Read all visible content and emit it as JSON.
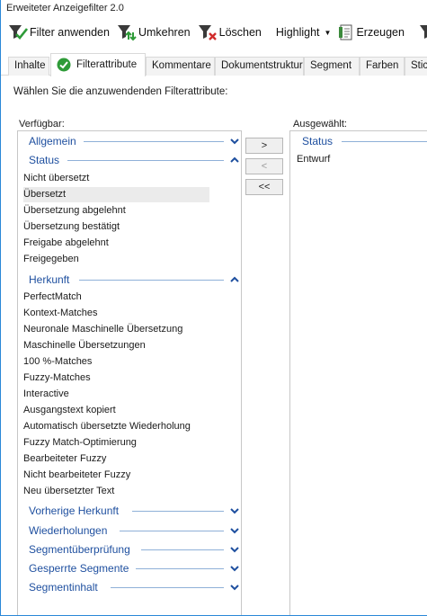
{
  "window": {
    "title": "Erweiteter Anzeigefilter 2.0"
  },
  "toolbar": {
    "apply_label": "Filter anwenden",
    "invert_label": "Umkehren",
    "clear_label": "Löschen",
    "highlight_label": "Highlight",
    "generate_label": "Erzeugen"
  },
  "tabs": [
    {
      "label": "Inhalte"
    },
    {
      "label": "Filterattribute",
      "active": true
    },
    {
      "label": "Kommentare"
    },
    {
      "label": "Dokumentstruktur"
    },
    {
      "label": "Segment"
    },
    {
      "label": "Farben"
    },
    {
      "label": "Stic"
    }
  ],
  "main": {
    "instruction": "Wählen Sie die anzuwendenden Filterattribute:",
    "available_label": "Verfügbar:",
    "selected_label": "Ausgewählt:"
  },
  "available": {
    "group_allgemein": "Allgemein",
    "group_status": "Status",
    "status_items": [
      "Nicht übersetzt",
      "Übersetzt",
      "Übersetzung abgelehnt",
      "Übersetzung bestätigt",
      "Freigabe abgelehnt",
      "Freigegeben"
    ],
    "group_herkunft": "Herkunft",
    "herkunft_items": [
      "PerfectMatch",
      "Kontext-Matches",
      "Neuronale Maschinelle Übersetzung",
      "Maschinelle Übersetzungen",
      "100 %-Matches",
      "Fuzzy-Matches",
      "Interactive",
      "Ausgangstext kopiert",
      "Automatisch übersetzte Wiederholung",
      "Fuzzy Match-Optimierung",
      "Bearbeiteter Fuzzy",
      "Nicht bearbeiteter Fuzzy",
      "Neu übersetzter Text"
    ],
    "collapsed_groups": [
      "Vorherige Herkunft",
      "Wiederholungen",
      "Segmentüberprüfung",
      "Gesperrte Segmente",
      "Segmentinhalt"
    ]
  },
  "buttons": {
    "add": ">",
    "remove": "<",
    "remove_all": "<<"
  },
  "selected": {
    "group_status": "Status",
    "items": [
      "Entwurf"
    ]
  }
}
